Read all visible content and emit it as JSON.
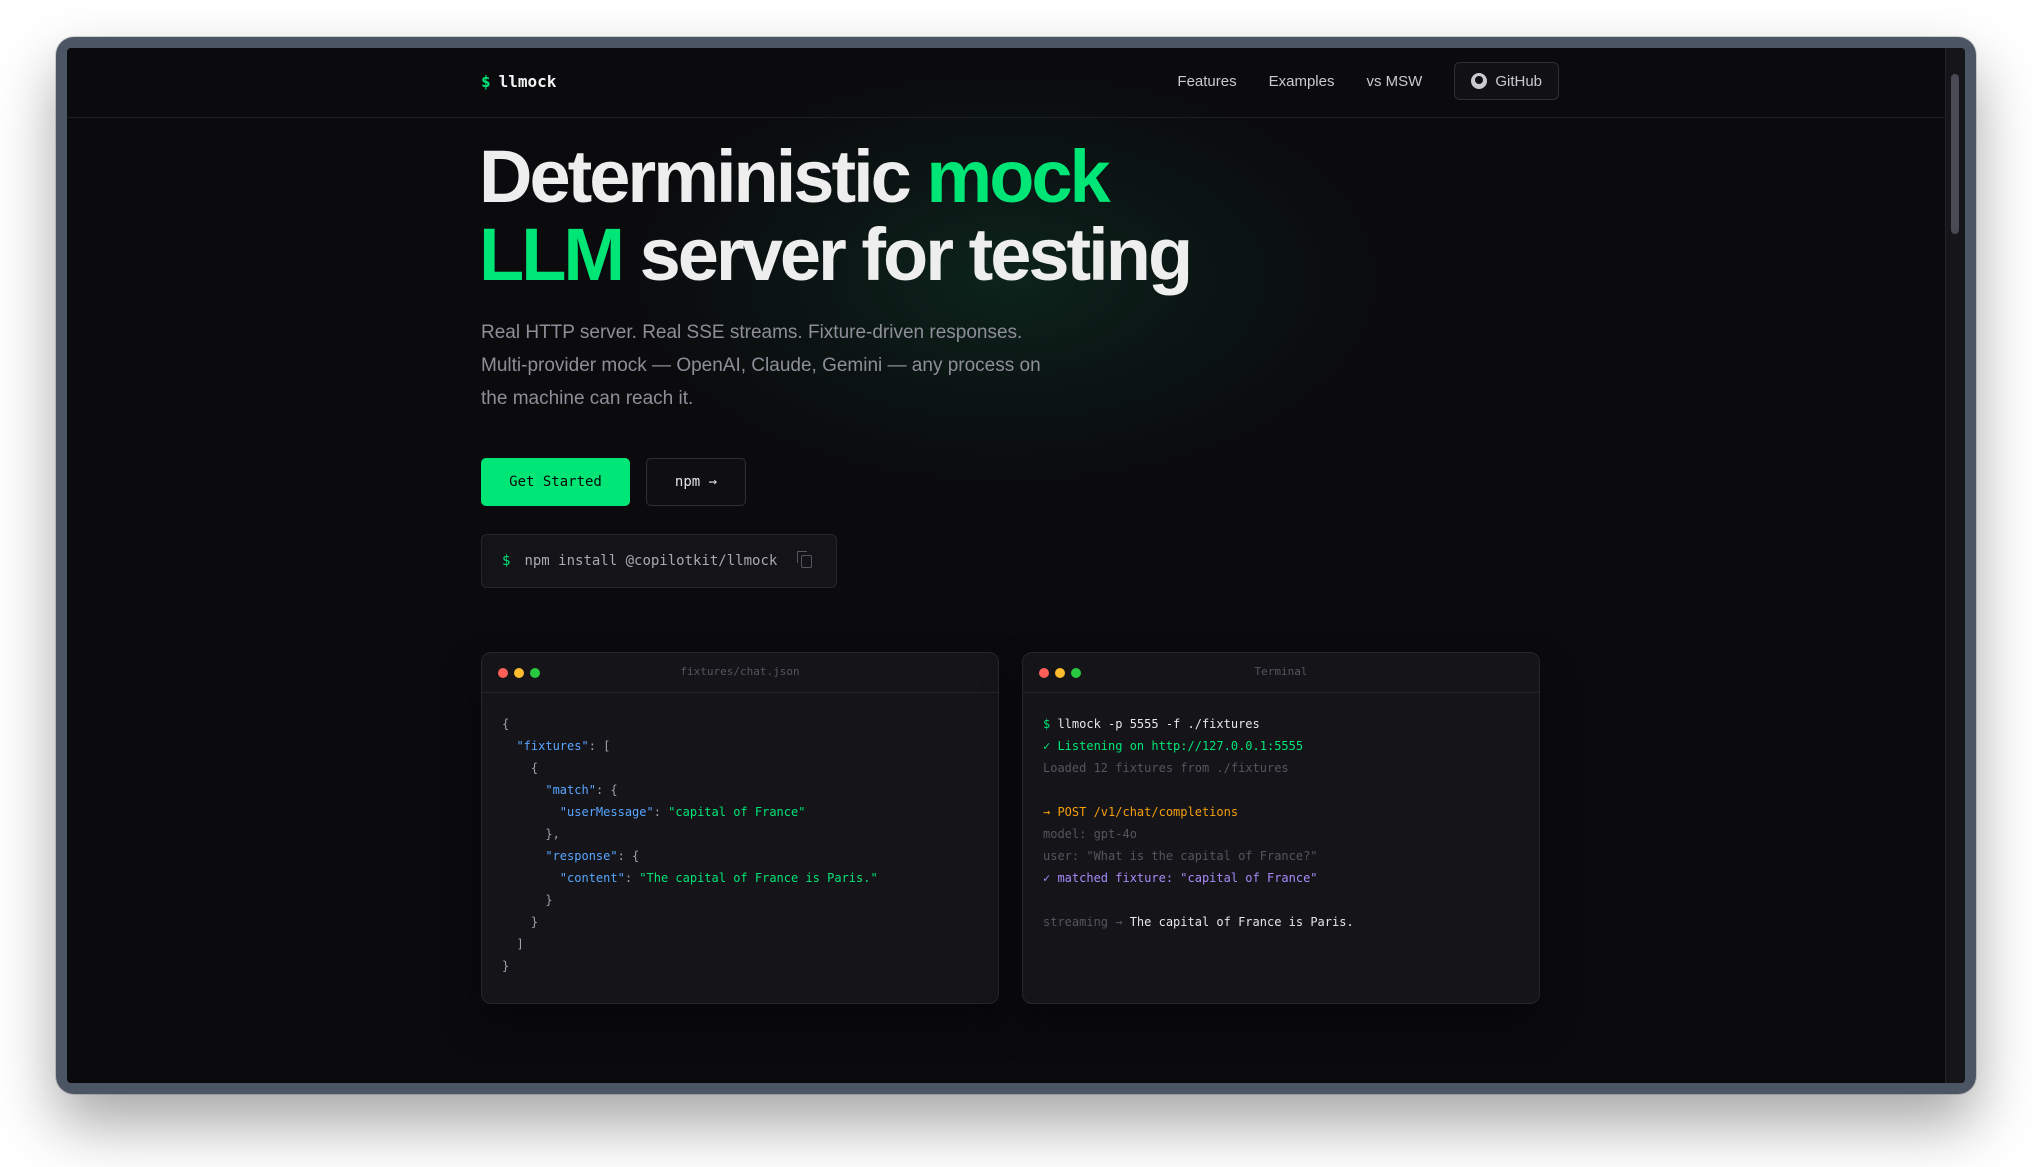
{
  "nav": {
    "logo_prompt": "$",
    "logo_text": "llmock",
    "links": [
      "Features",
      "Examples",
      "vs MSW"
    ],
    "github_label": "GitHub"
  },
  "hero": {
    "title_part1": "Deterministic",
    "title_accent1": "mock",
    "title_accent2": "LLM",
    "title_part2": "server for testing",
    "subtitle_line1": "Real HTTP server. Real SSE streams. Fixture-driven responses.",
    "subtitle_line2": "Multi-provider mock — OpenAI, Claude, Gemini — any process on",
    "subtitle_line3": "the machine can reach it.",
    "primary_button": "Get Started",
    "secondary_button": "npm →",
    "install_prompt": "$",
    "install_command": "npm install @copilotkit/llmock"
  },
  "fixture_panel": {
    "title": "fixtures/chat.json",
    "lines": [
      [
        {
          "t": "punc",
          "v": "{"
        }
      ],
      [
        {
          "t": "punc",
          "v": "  "
        },
        {
          "t": "key",
          "v": "\"fixtures\""
        },
        {
          "t": "punc",
          "v": ": ["
        }
      ],
      [
        {
          "t": "punc",
          "v": "    {"
        }
      ],
      [
        {
          "t": "punc",
          "v": "      "
        },
        {
          "t": "key",
          "v": "\"match\""
        },
        {
          "t": "punc",
          "v": ": {"
        }
      ],
      [
        {
          "t": "punc",
          "v": "        "
        },
        {
          "t": "key",
          "v": "\"userMessage\""
        },
        {
          "t": "punc",
          "v": ": "
        },
        {
          "t": "str",
          "v": "\"capital of France\""
        }
      ],
      [
        {
          "t": "punc",
          "v": "      },"
        }
      ],
      [
        {
          "t": "punc",
          "v": "      "
        },
        {
          "t": "key",
          "v": "\"response\""
        },
        {
          "t": "punc",
          "v": ": {"
        }
      ],
      [
        {
          "t": "punc",
          "v": "        "
        },
        {
          "t": "key",
          "v": "\"content\""
        },
        {
          "t": "punc",
          "v": ": "
        },
        {
          "t": "str",
          "v": "\"The capital of France is Paris.\""
        }
      ],
      [
        {
          "t": "punc",
          "v": "      }"
        }
      ],
      [
        {
          "t": "punc",
          "v": "    }"
        }
      ],
      [
        {
          "t": "punc",
          "v": "  ]"
        }
      ],
      [
        {
          "t": "punc",
          "v": "}"
        }
      ]
    ]
  },
  "terminal_panel": {
    "title": "Terminal",
    "lines": [
      [
        {
          "t": "dollar",
          "v": "$ "
        },
        {
          "t": "white",
          "v": "llmock -p 5555 -f ./fixtures"
        }
      ],
      [
        {
          "t": "green",
          "v": "✓ Listening on http://127.0.0.1:5555"
        }
      ],
      [
        {
          "t": "dim",
          "v": "Loaded 12 fixtures from ./fixtures"
        }
      ],
      [
        {
          "t": "dim",
          "v": " "
        }
      ],
      [
        {
          "t": "orange",
          "v": "→ POST /v1/chat/completions"
        }
      ],
      [
        {
          "t": "dim",
          "v": "model: gpt-4o"
        }
      ],
      [
        {
          "t": "dim",
          "v": "user: \"What is the capital of France?\""
        }
      ],
      [
        {
          "t": "purple",
          "v": "✓ matched fixture: \"capital of France\""
        }
      ],
      [
        {
          "t": "dim",
          "v": " "
        }
      ],
      [
        {
          "t": "dim",
          "v": "streaming → "
        },
        {
          "t": "white",
          "v": "The capital of France is Paris."
        }
      ]
    ]
  }
}
